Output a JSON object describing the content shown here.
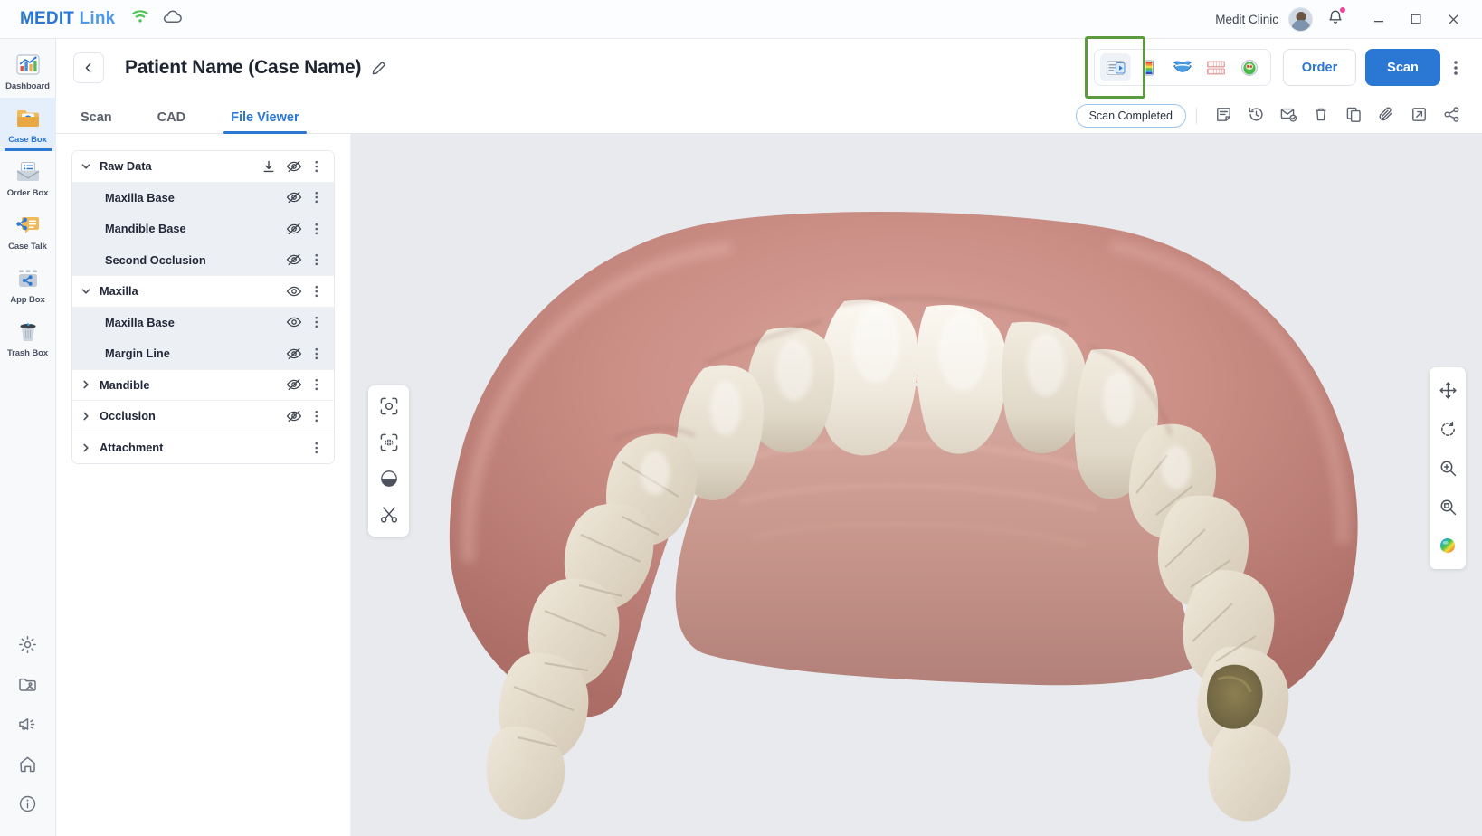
{
  "titlebar": {
    "brand_primary": "MEDIT",
    "brand_secondary": "Link",
    "wifi_icon": "wifi-icon",
    "cloud_icon": "cloud-icon",
    "clinic": "Medit Clinic",
    "avatar": "user-avatar",
    "notification_icon": "bell-icon",
    "minimize": "minimize-icon",
    "maximize": "maximize-icon",
    "close": "close-icon"
  },
  "sidebar": {
    "items": [
      {
        "label": "Dashboard",
        "icon": "dashboard-chart-icon",
        "active": false
      },
      {
        "label": "Case Box",
        "icon": "case-box-folder-icon",
        "active": true
      },
      {
        "label": "Order Box",
        "icon": "order-box-envelope-icon",
        "active": false
      },
      {
        "label": "Case Talk",
        "icon": "case-talk-share-icon",
        "active": false
      },
      {
        "label": "App Box",
        "icon": "app-box-toolbox-icon",
        "active": false
      },
      {
        "label": "Trash Box",
        "icon": "trash-bin-icon",
        "active": false
      }
    ],
    "bottom_items": [
      {
        "icon": "gear-icon"
      },
      {
        "icon": "folder-image-icon"
      },
      {
        "icon": "megaphone-icon"
      },
      {
        "icon": "home-icon"
      },
      {
        "icon": "info-icon"
      }
    ]
  },
  "header": {
    "back_icon": "chevron-left-icon",
    "title": "Patient Name (Case Name)",
    "edit_icon": "pencil-edit-icon",
    "mode_buttons": [
      {
        "name": "scan-data-view",
        "icon": "scan-data-icon",
        "selected": true,
        "highlighted": true
      },
      {
        "name": "color-map-view",
        "icon": "color-map-icon",
        "selected": false,
        "highlighted": false
      },
      {
        "name": "lips-view",
        "icon": "lips-smile-icon",
        "selected": false,
        "highlighted": false
      },
      {
        "name": "occlusion-view",
        "icon": "teeth-occlusion-icon",
        "selected": false,
        "highlighted": false
      },
      {
        "name": "intraoral-camera-view",
        "icon": "intraoral-camera-icon",
        "selected": false,
        "highlighted": false
      }
    ],
    "highlight_color": "#5b9b3e",
    "order_label": "Order",
    "scan_label": "Scan",
    "kebab_icon": "more-vertical-icon"
  },
  "tabs": {
    "items": [
      {
        "label": "Scan",
        "active": false
      },
      {
        "label": "CAD",
        "active": false
      },
      {
        "label": "File Viewer",
        "active": true
      }
    ],
    "status": "Scan Completed",
    "actions": [
      {
        "name": "memo-note-icon"
      },
      {
        "name": "history-clock-icon"
      },
      {
        "name": "mail-send-icon"
      },
      {
        "name": "delete-trash-icon"
      },
      {
        "name": "copy-duplicate-icon"
      },
      {
        "name": "attachment-clip-icon"
      },
      {
        "name": "export-arrow-icon"
      },
      {
        "name": "share-nodes-icon"
      }
    ]
  },
  "tree": {
    "rows": [
      {
        "label": "Raw Data",
        "level": 0,
        "caret": "down",
        "download": true,
        "eye": "hidden",
        "kebab": true
      },
      {
        "label": "Maxilla Base",
        "level": 1,
        "caret": "none",
        "download": false,
        "eye": "hidden",
        "kebab": true
      },
      {
        "label": "Mandible Base",
        "level": 1,
        "caret": "none",
        "download": false,
        "eye": "hidden",
        "kebab": true
      },
      {
        "label": "Second Occlusion",
        "level": 1,
        "caret": "none",
        "download": false,
        "eye": "hidden",
        "kebab": true
      },
      {
        "label": "Maxilla",
        "level": 0,
        "caret": "down",
        "download": false,
        "eye": "visible",
        "kebab": true
      },
      {
        "label": "Maxilla Base",
        "level": 1,
        "caret": "none",
        "download": false,
        "eye": "visible",
        "kebab": true
      },
      {
        "label": "Margin Line",
        "level": 1,
        "caret": "none",
        "download": false,
        "eye": "hidden",
        "kebab": true
      },
      {
        "label": "Mandible",
        "level": 0,
        "caret": "right",
        "download": false,
        "eye": "hidden",
        "kebab": true
      },
      {
        "label": "Occlusion",
        "level": 0,
        "caret": "right",
        "download": false,
        "eye": "hidden",
        "kebab": true
      },
      {
        "label": "Attachment",
        "level": 0,
        "caret": "right",
        "download": false,
        "eye": "none",
        "kebab": true
      }
    ]
  },
  "viewport": {
    "background_color": "#e8eaee",
    "model_description": "3D intraoral scan of maxillary dental arch, occlusal view",
    "left_tools": [
      {
        "name": "select-area-icon"
      },
      {
        "name": "select-teeth-icon"
      },
      {
        "name": "fill-hole-icon"
      },
      {
        "name": "scissors-trim-icon"
      }
    ],
    "right_tools": [
      {
        "name": "pan-move-icon"
      },
      {
        "name": "rotate-reset-icon"
      },
      {
        "name": "zoom-in-icon"
      },
      {
        "name": "zoom-fit-icon"
      },
      {
        "name": "color-sphere-icon"
      }
    ]
  }
}
